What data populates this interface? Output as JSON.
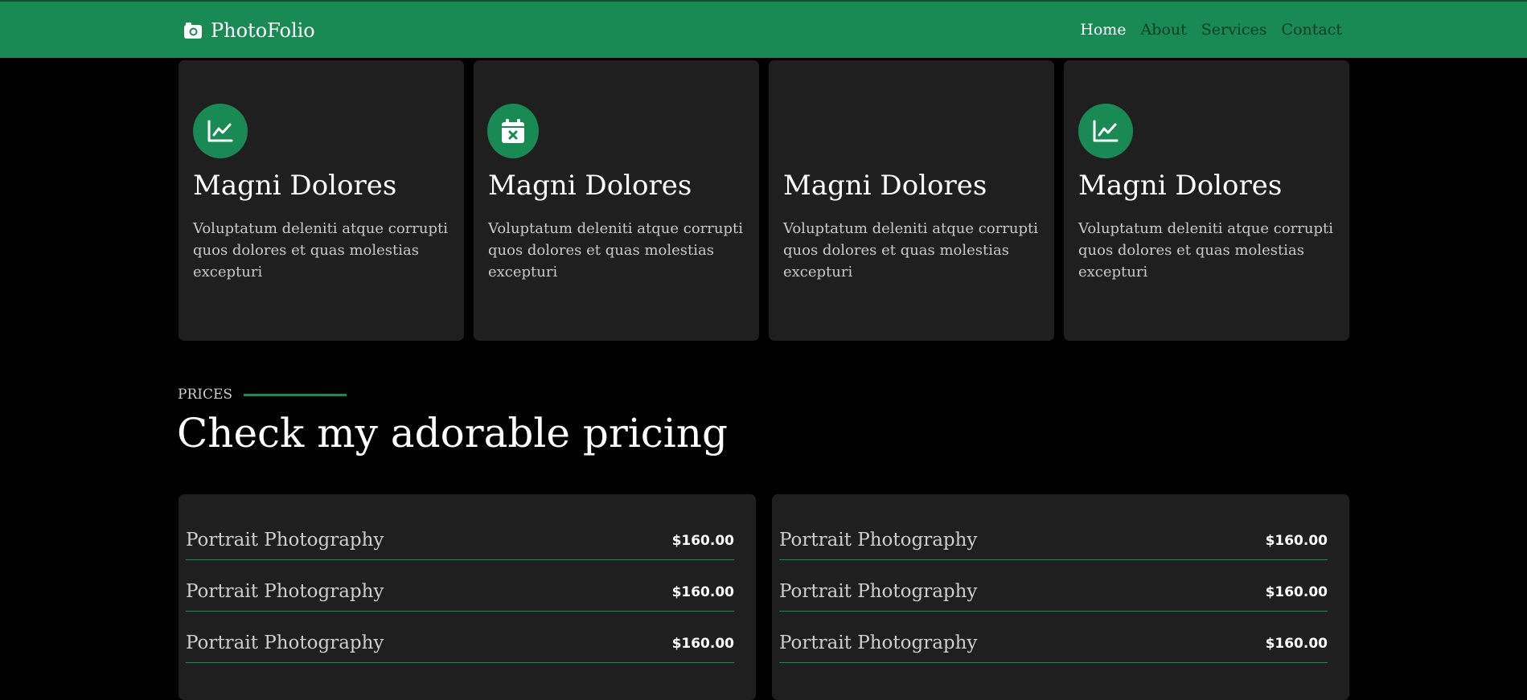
{
  "brand": {
    "name": "PhotoFolio",
    "icon": "camera-icon"
  },
  "nav": {
    "items": [
      {
        "label": "Home",
        "active": true
      },
      {
        "label": "About",
        "active": false
      },
      {
        "label": "Services",
        "active": false
      },
      {
        "label": "Contact",
        "active": false
      }
    ]
  },
  "services": [
    {
      "icon": "chart-line-icon",
      "title": "Magni Dolores",
      "text": "Voluptatum deleniti atque corrupti quos dolores et quas molestias excepturi"
    },
    {
      "icon": "calendar-x-icon",
      "title": "Magni Dolores",
      "text": "Voluptatum deleniti atque corrupti quos dolores et quas molestias excepturi"
    },
    {
      "icon": "",
      "title": "Magni Dolores",
      "text": "Voluptatum deleniti atque corrupti quos dolores et quas molestias excepturi"
    },
    {
      "icon": "chart-line-icon",
      "title": "Magni Dolores",
      "text": "Voluptatum deleniti atque corrupti quos dolores et quas molestias excepturi"
    }
  ],
  "pricing": {
    "label": "PRICES",
    "title": "Check my adorable pricing",
    "columns": [
      [
        {
          "name": "Portrait Photography",
          "price": "$160.00"
        },
        {
          "name": "Portrait Photography",
          "price": "$160.00"
        },
        {
          "name": "Portrait Photography",
          "price": "$160.00"
        }
      ],
      [
        {
          "name": "Portrait Photography",
          "price": "$160.00"
        },
        {
          "name": "Portrait Photography",
          "price": "$160.00"
        },
        {
          "name": "Portrait Photography",
          "price": "$160.00"
        }
      ]
    ]
  },
  "colors": {
    "accent": "#1a8a55",
    "card": "#201f20",
    "background": "#000000"
  }
}
